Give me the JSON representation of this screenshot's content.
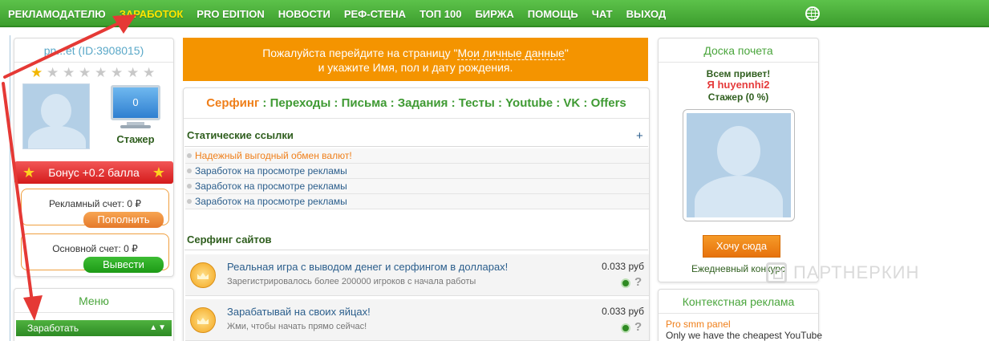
{
  "nav": {
    "items": [
      "РЕКЛАМОДАТЕЛЮ",
      "ЗАРАБОТОК",
      "PRO EDITION",
      "НОВОСТИ",
      "РЕФ-СТЕНА",
      "ТОП 100",
      "БИРЖА",
      "ПОМОЩЬ",
      "ЧАТ",
      "ВЫХОД"
    ],
    "active": "ЗАРАБОТОК",
    "globe_icon": "globe-icon"
  },
  "profile": {
    "username": "pn...et (ID:3908015)",
    "stars_filled": 1,
    "stars_total": 8,
    "monitor_value": "0",
    "rank": "Стажер",
    "bonus": "Бонус +0.2 балла",
    "ad_account": {
      "label": "Рекламный счет: 0 ₽",
      "button": "Пополнить"
    },
    "main_account": {
      "label": "Основной счет: 0 ₽",
      "button": "Вывести"
    }
  },
  "menu": {
    "title": "Меню",
    "item": "Заработать"
  },
  "notice": {
    "line1_pre": "Пожалуйста перейдите на страницу \"",
    "link": "Мои личные данные",
    "line1_post": "\"",
    "line2": "и укажите Имя, пол и дату рождения."
  },
  "tabs": [
    "Серфинг",
    "Переходы",
    "Письма",
    "Задания",
    "Тесты",
    "Youtube",
    "VK",
    "Offers"
  ],
  "tab_separator": " : ",
  "static_links": {
    "title": "Статические ссылки",
    "plus": "+",
    "items": [
      "Надежный выгодный обмен валют!",
      "Заработок на просмотре рекламы",
      "Заработок на просмотре рекламы",
      "Заработок на просмотре рекламы"
    ]
  },
  "surfing": {
    "title": "Серфинг сайтов",
    "items": [
      {
        "title": "Реальная игра с выводом денег и серфингом в долларах!",
        "subtitle": "Зарегистрировалось более 200000 игроков с начала работы",
        "price": "0.033 руб"
      },
      {
        "title": "Зарабатывай на своих яйцах!",
        "subtitle": "Жми, чтобы начать прямо сейчас!",
        "price": "0.033 руб"
      }
    ]
  },
  "honor": {
    "title": "Доска почета",
    "greeting": "Всем привет!",
    "name_prefix": "Я ",
    "name": "huyennhi2",
    "rank": "Стажер (0 %)",
    "button": "Хочу сюда",
    "daily": "Ежедневный конкурс"
  },
  "context": {
    "title": "Контекстная реклама",
    "link": "Pro smm panel",
    "text": "Only we have the cheapest YouTube"
  },
  "watermark": "ПАРТНЕРКИН",
  "colors": {
    "nav_green": "#4cb23c",
    "accent_orange": "#f49400",
    "arrow_red": "#e53935"
  }
}
